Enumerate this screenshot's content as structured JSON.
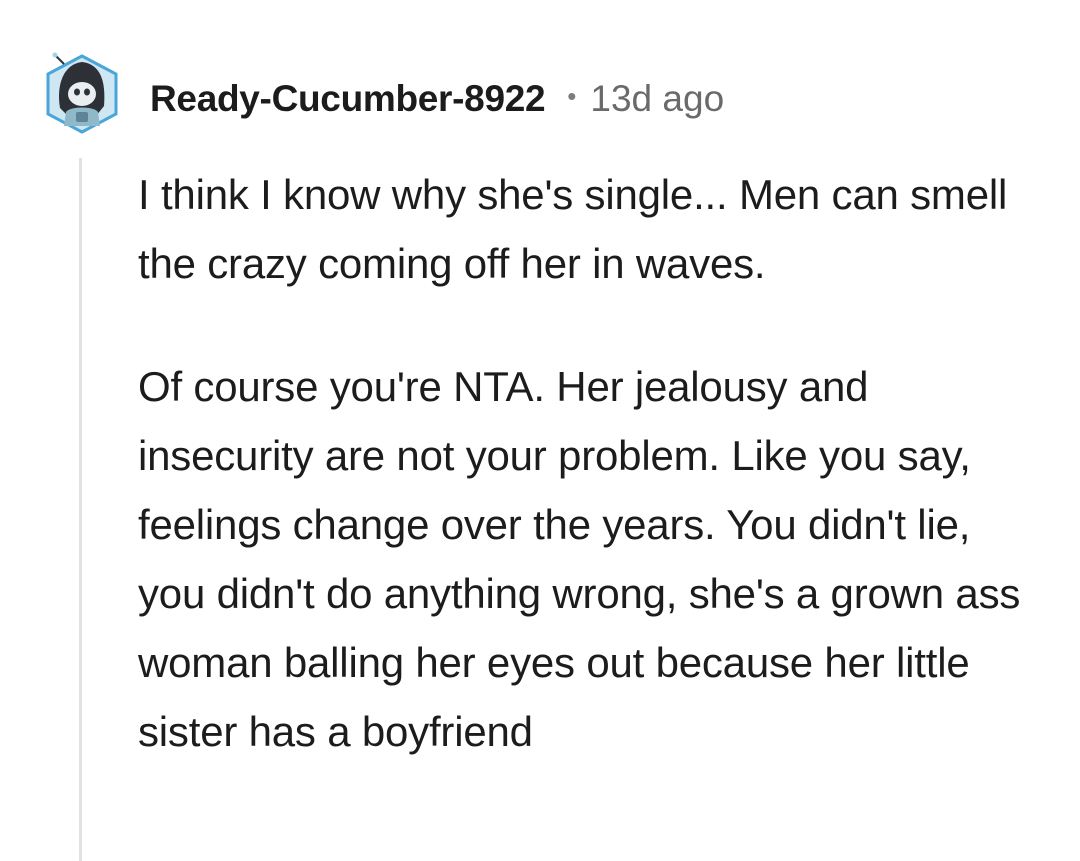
{
  "comment": {
    "author": "Ready-Cucumber-8922",
    "separator": "•",
    "age": "13d ago",
    "paragraphs": [
      "I think I know why she's single... Men can smell the crazy coming off her in waves.",
      "Of course you're NTA. Her jealousy and insecurity are not your problem. Like you say, feelings change over the years. You didn't lie, you didn't do anything wrong, she's a grown ass woman balling her eyes out because her little sister has a boyfriend"
    ],
    "avatar_icon": "snoo-avatar-icon"
  },
  "colors": {
    "username": "#1c1c1c",
    "timestamp": "#6a6a6a",
    "thread_line": "#e1e1e1",
    "avatar_frame": "#4aa6d8"
  }
}
